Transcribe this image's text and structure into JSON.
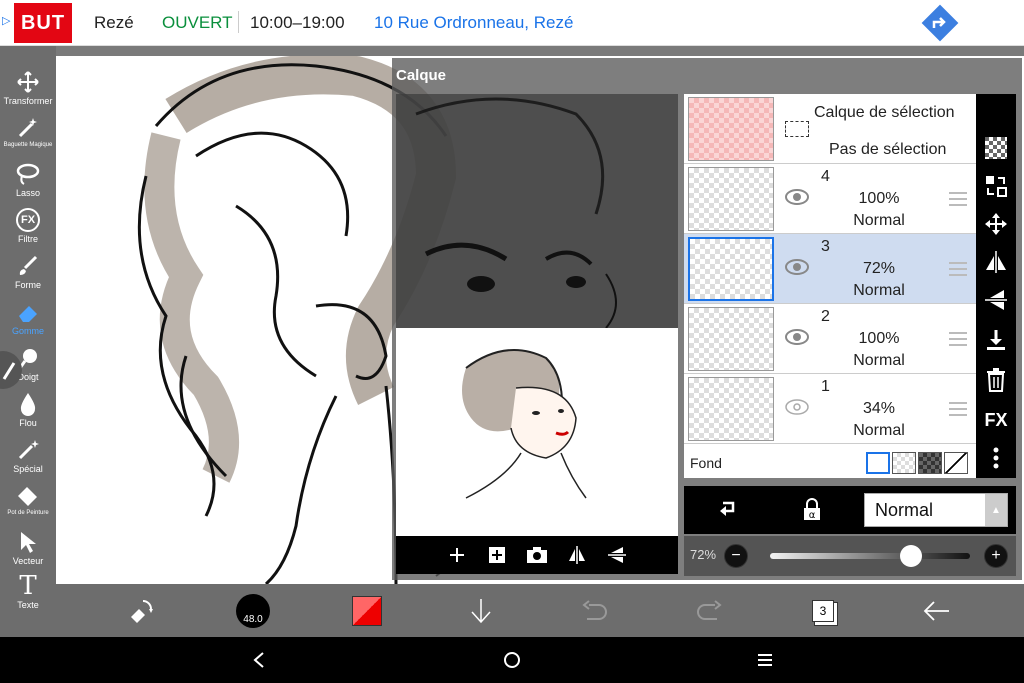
{
  "ad": {
    "brand": "BUT",
    "city": "Rezé",
    "status": "OUVERT",
    "hours": "10:00–19:00",
    "address": "10 Rue Ordronneau, Rezé",
    "icons": [
      "adchoices-icon",
      "directions-icon"
    ],
    "colors": {
      "brand": "#e30613",
      "status": "#0a8f3c",
      "link": "#1a73e8"
    }
  },
  "toolbar": {
    "tools": [
      {
        "label": "Transformer",
        "icon": "move-icon"
      },
      {
        "label": "Baguette Magique",
        "icon": "magic-wand-icon"
      },
      {
        "label": "Lasso",
        "icon": "lasso-icon"
      },
      {
        "label": "Filtre",
        "icon": "fx-icon",
        "glyph": "FX"
      },
      {
        "label": "Forme",
        "icon": "brush-icon"
      },
      {
        "label": "Gomme",
        "icon": "eraser-icon",
        "active": true
      },
      {
        "label": "Doigt",
        "icon": "smudge-icon"
      },
      {
        "label": "Flou",
        "icon": "blur-drop-icon"
      },
      {
        "label": "Spécial",
        "icon": "special-brush-icon"
      },
      {
        "label": "Pot de Peinture",
        "icon": "paint-bucket-icon"
      },
      {
        "label": "Vecteur",
        "icon": "vector-arrow-icon"
      },
      {
        "label": "Texte",
        "icon": "text-icon",
        "glyph": "T"
      }
    ],
    "active_color": "#4aa3ff"
  },
  "calque": {
    "title": "Calque",
    "selection_layer": {
      "title": "Calque de sélection",
      "subtitle": "Pas de sélection"
    },
    "layers": [
      {
        "number": "4",
        "opacity": "100%",
        "mode": "Normal",
        "visible": true,
        "selected": false
      },
      {
        "number": "3",
        "opacity": "72%",
        "mode": "Normal",
        "visible": true,
        "selected": true
      },
      {
        "number": "2",
        "opacity": "100%",
        "mode": "Normal",
        "visible": true,
        "selected": false
      },
      {
        "number": "1",
        "opacity": "34%",
        "mode": "Normal",
        "visible": true,
        "selected": false
      }
    ],
    "fond_label": "Fond",
    "blend_mode": "Normal",
    "opacity_label": "72%",
    "opacity_value": 72,
    "minus": "−",
    "plus": "+",
    "fx": "FX",
    "preview_tools": [
      "add-icon",
      "add-layer-icon",
      "camera-icon",
      "flip-horizontal-icon",
      "flip-vertical-icon"
    ],
    "side_tools": [
      "transparency-icon",
      "swap-icon",
      "move-icon",
      "flip-horizontal-icon",
      "flip-vertical-icon",
      "merge-down-icon",
      "trash-icon",
      "fx-icon",
      "more-icon"
    ]
  },
  "bottom": {
    "brush_size": "48.0",
    "layer_count": "3",
    "icons": [
      "swap-tool-icon",
      "brush-size-icon",
      "color-swatch-icon",
      "download-icon",
      "undo-icon",
      "redo-icon",
      "layers-icon",
      "back-icon"
    ]
  },
  "android": {
    "icons": [
      "back-icon",
      "home-icon",
      "menu-icon"
    ]
  }
}
